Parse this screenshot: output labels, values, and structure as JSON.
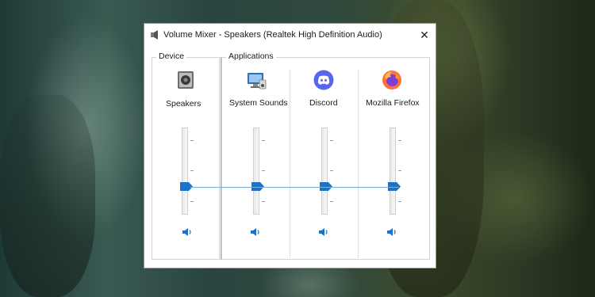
{
  "window": {
    "title": "Volume Mixer - Speakers (Realtek High Definition Audio)",
    "close_glyph": "✕"
  },
  "groups": {
    "device_label": "Device",
    "applications_label": "Applications"
  },
  "channels": [
    {
      "label": "Speakers",
      "icon": "speaker-device-icon",
      "volume": 0.3
    },
    {
      "label": "System Sounds",
      "icon": "system-sounds-icon",
      "volume": 0.3
    },
    {
      "label": "Discord",
      "icon": "discord-icon",
      "volume": 0.3
    },
    {
      "label": "Mozilla Firefox",
      "icon": "firefox-icon",
      "volume": 0.3
    }
  ],
  "colors": {
    "accent": "#1a73c7",
    "discord": "#5865f2",
    "firefox_orange": "#ff7139",
    "firefox_purple": "#7f3dd8"
  }
}
